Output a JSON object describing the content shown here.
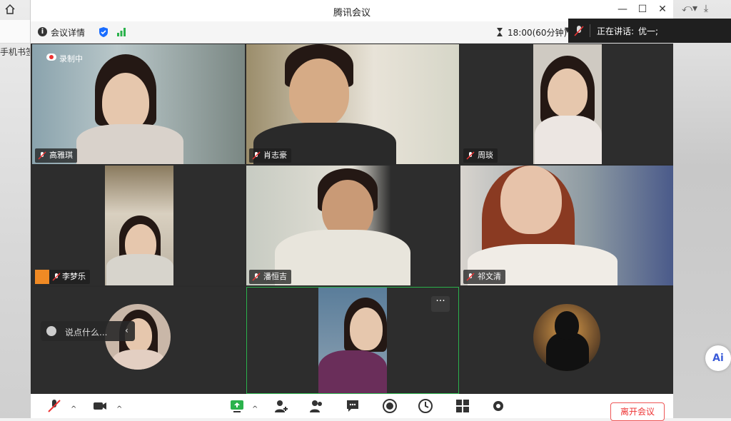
{
  "window": {
    "title": "腾讯会议",
    "minimize": "—",
    "maximize": "☐",
    "close": "✕"
  },
  "toolbar": {
    "info_label": "会议详情",
    "timer_label": "18:00(60分钟)",
    "speaker_label": "正在讲话:",
    "speaker_name": "优一;"
  },
  "background": {
    "left_text": "手机书签"
  },
  "recording": {
    "label": "录制中"
  },
  "participants": [
    {
      "name": "高雅琪"
    },
    {
      "name": "肖志豪"
    },
    {
      "name": "周琰"
    },
    {
      "name": "李梦乐"
    },
    {
      "name": "潘恒吉"
    },
    {
      "name": "祁文清"
    }
  ],
  "chat": {
    "placeholder": "说点什么..."
  },
  "bottombar": {
    "leave_label": "离开会议"
  },
  "colors": {
    "accent_green": "#2bb24c",
    "leave_red": "#e33333",
    "brand_blue": "#1a6dff"
  },
  "icons": [
    "home-icon",
    "info-icon",
    "shield-icon",
    "signal-icon",
    "hourglass-icon",
    "grid-icon",
    "mic-muted-icon",
    "camera-icon",
    "share-screen-icon",
    "invite-icon",
    "members-icon",
    "chat-icon",
    "record-icon",
    "app-icon",
    "settings-icon",
    "more-icon",
    "smile-icon"
  ]
}
